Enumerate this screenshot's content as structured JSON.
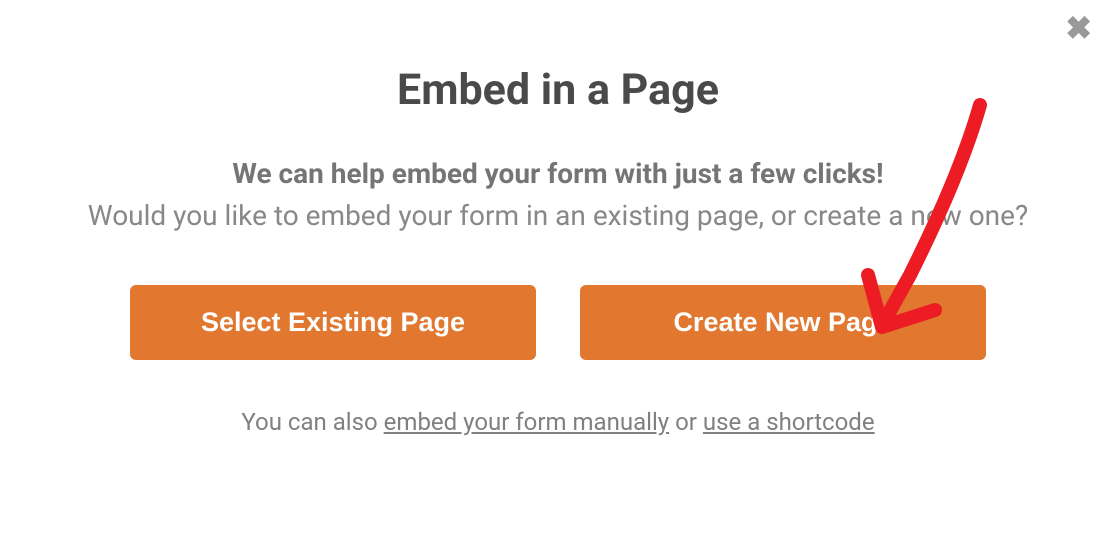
{
  "modal": {
    "title": "Embed in a Page",
    "subtitle_bold": "We can help embed your form with just a few clicks!",
    "subtitle_regular": "Would you like to embed your form in an existing page, or create a new one?",
    "button_select_existing": "Select Existing Page",
    "button_create_new": "Create New Page",
    "footer_prefix": "You can also ",
    "footer_link_manual": "embed your form manually",
    "footer_middle": " or ",
    "footer_link_shortcode": "use a shortcode"
  }
}
